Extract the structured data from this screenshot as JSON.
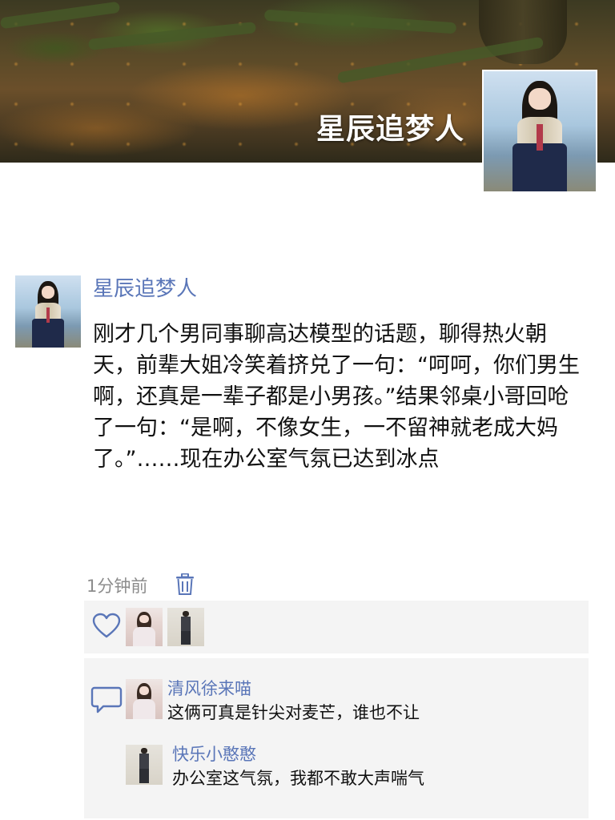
{
  "profile": {
    "cover_name": "星辰追梦人"
  },
  "post": {
    "author": "星辰追梦人",
    "content": "刚才几个男同事聊高达模型的话题，聊得热火朝天，前辈大姐冷笑着挤兑了一句：“呵呵，你们男生啊，还真是一辈子都是小男孩。”结果邻桌小哥回呛了一句：“是啊，不像女生，一不留神就老成大妈了。”……现在办公室气氛已达到冰点",
    "time": "1分钟前"
  },
  "likes": {
    "icon": "heart-icon"
  },
  "comments": [
    {
      "name": "清风徐来喵",
      "text": "这俩可真是针尖对麦芒，谁也不让"
    },
    {
      "name": "快乐小憨憨",
      "text": "办公室这气氛，我都不敢大声喘气"
    }
  ],
  "colors": {
    "name_blue": "#5a76b8",
    "panel_bg": "#f4f4f4",
    "time_gray": "#8c8c8c"
  }
}
